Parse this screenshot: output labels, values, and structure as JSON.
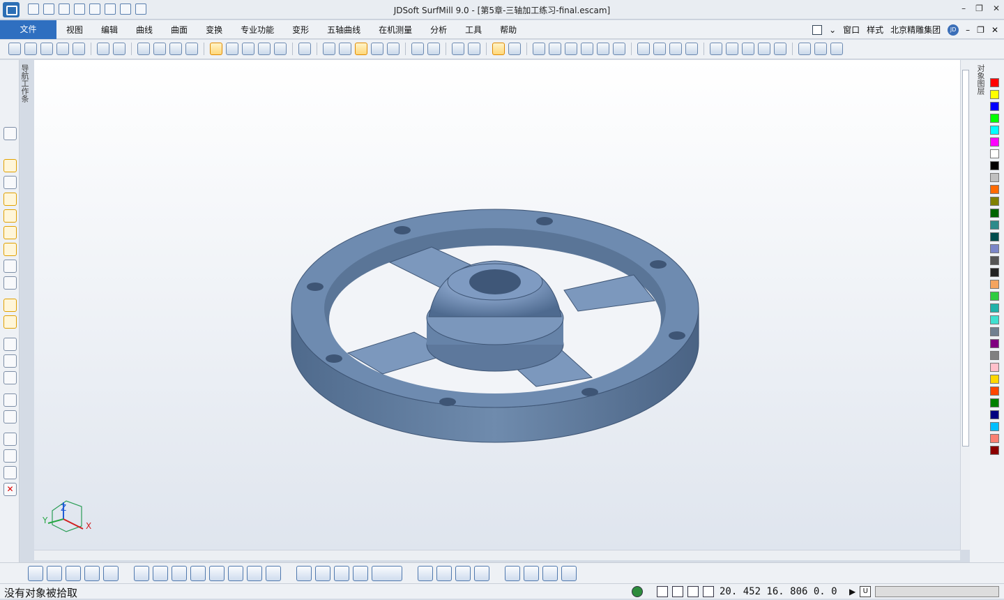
{
  "window": {
    "title": "JDSoft SurfMill 9.0 - [第5章-三轴加工练习-final.escam]"
  },
  "menu": {
    "file_tab": "文件",
    "items": [
      "视图",
      "编辑",
      "曲线",
      "曲面",
      "变换",
      "专业功能",
      "变形",
      "五轴曲线",
      "在机测量",
      "分析",
      "工具",
      "帮助"
    ],
    "right": {
      "window_label": "窗口",
      "style_label": "样式",
      "company_label": "北京精雕集团",
      "badge": "JD"
    }
  },
  "left_panel": {
    "label": "导航工作条"
  },
  "right_panel": {
    "label": "对象图层"
  },
  "palette": [
    "#ff0000",
    "#ffff00",
    "#0000ff",
    "#00ff00",
    "#00ffff",
    "#ff00ff",
    "#ffffff",
    "#000000",
    "#c0c0c0",
    "#ff6a00",
    "#808000",
    "#006400",
    "#2e8b8b",
    "#004d4d",
    "#7b86c8",
    "#555555",
    "#222222",
    "#f4a460",
    "#2ecc40",
    "#20b2aa",
    "#40e0d0",
    "#708090",
    "#800080",
    "#808080",
    "#ffc0cb",
    "#ffd700",
    "#ff4500",
    "#008000",
    "#000080",
    "#00bfff",
    "#fa8072",
    "#8b0000"
  ],
  "viewport": {
    "axis_labels": {
      "x": "X",
      "y": "Y",
      "z": "Z"
    }
  },
  "status": {
    "message": "没有对象被拾取",
    "coords": "20. 452  16. 806  0. 0",
    "u_label": "U"
  }
}
